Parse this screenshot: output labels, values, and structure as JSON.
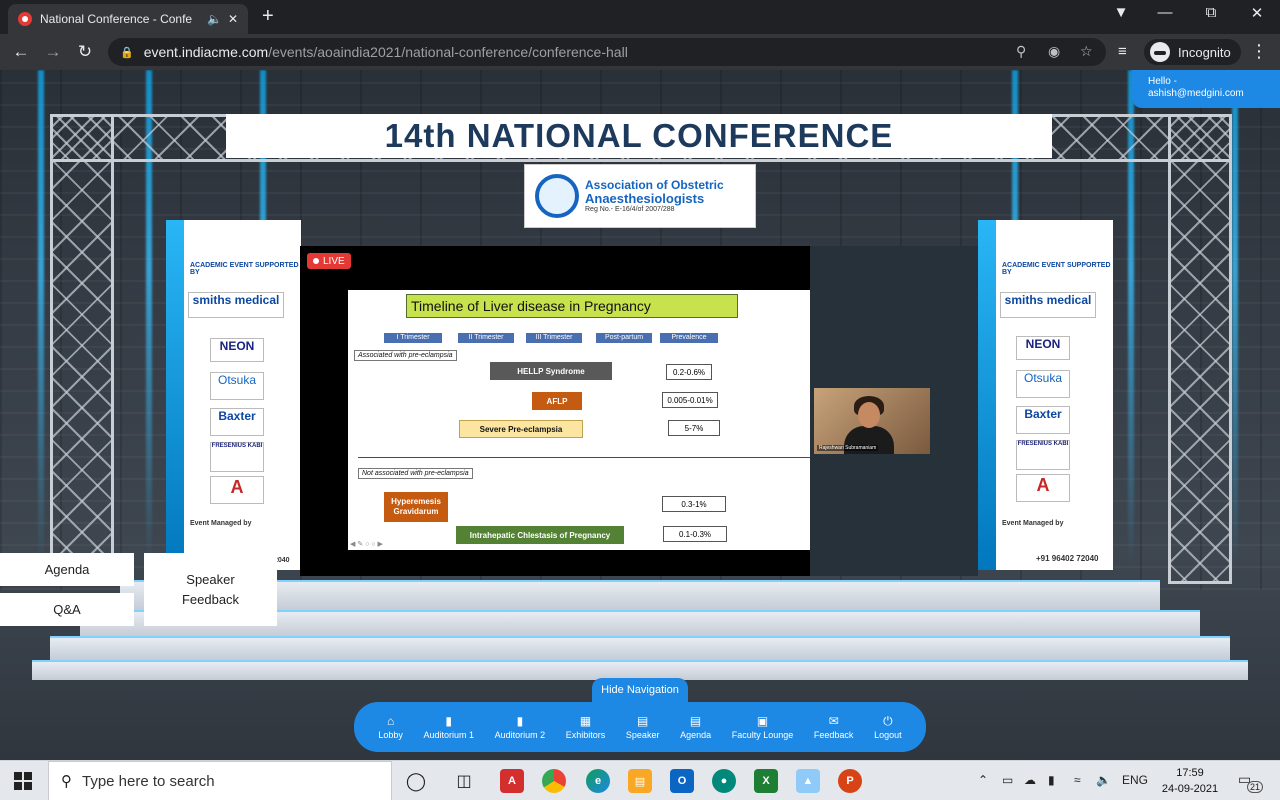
{
  "browser": {
    "tab_title": "National Conference - Confe",
    "url_domain": "event.indiacme.com",
    "url_path": "/events/aoaindia2021/national-conference/conference-hall",
    "profile_label": "Incognito"
  },
  "user": {
    "greeting": "Hello -",
    "email": "ashish@medgini.com"
  },
  "stage": {
    "banner_title": "14th NATIONAL CONFERENCE",
    "org_line1": "Association of Obstetric",
    "org_line2": "Anaesthesiologists",
    "org_reg": "Reg No.- E-16/4/of 2007/288",
    "live_label": "LIVE",
    "side_heading": "ACADEMIC EVENT SUPPORTED BY",
    "sponsors": [
      "smiths medical",
      "NEON",
      "Otsuka",
      "Baxter",
      "FRESENIUS KABI"
    ],
    "managed_by": "Event Managed by",
    "phone_right": "+91 96402 72040",
    "phone_left": "2040"
  },
  "slide": {
    "title": "Timeline of Liver disease in Pregnancy",
    "trimesters": [
      "I Trimester",
      "II Trimester",
      "III Trimester",
      "Post-partum",
      "Prevalence"
    ],
    "group1_label": "Associated with pre-eclampsia",
    "group2_label": "Not associated with pre-eclampsia",
    "rows": [
      {
        "name": "HELLP Syndrome",
        "prevalence": "0.2-0.6%"
      },
      {
        "name": "AFLP",
        "prevalence": "0.005-0.01%"
      },
      {
        "name": "Severe Pre-eclampsia",
        "prevalence": "5-7%"
      },
      {
        "name": "Hyperemesis Gravidarum",
        "prevalence": "0.3-1%"
      },
      {
        "name": "Intrahepatic Chlestasis of Pregnancy",
        "prevalence": "0.1-0.3%"
      }
    ],
    "colors": {
      "hellp": "#595959",
      "aflp": "#c55a11",
      "severe": "#fbe5a0",
      "hyperemesis": "#c55a11",
      "cholestasis": "#548235"
    }
  },
  "camera": {
    "speaker_name": "Rajeshwari Subramaniam"
  },
  "side_buttons": {
    "agenda": "Agenda",
    "qa": "Q&A",
    "feedback": "Speaker Feedback"
  },
  "navigation": {
    "hide_label": "Hide Navigation",
    "items": [
      {
        "label": "Lobby",
        "icon": "home-icon"
      },
      {
        "label": "Auditorium 1",
        "icon": "door-icon"
      },
      {
        "label": "Auditorium 2",
        "icon": "door-icon"
      },
      {
        "label": "Exhibitors",
        "icon": "grid-icon"
      },
      {
        "label": "Speaker",
        "icon": "document-icon"
      },
      {
        "label": "Agenda",
        "icon": "document-icon"
      },
      {
        "label": "Faculty Lounge",
        "icon": "lounge-icon"
      },
      {
        "label": "Feedback",
        "icon": "feedback-icon"
      },
      {
        "label": "Logout",
        "icon": "power-icon"
      }
    ]
  },
  "taskbar": {
    "search_placeholder": "Type here to search",
    "language": "ENG",
    "time": "17:59",
    "date": "24-09-2021",
    "notification_count": "21"
  }
}
